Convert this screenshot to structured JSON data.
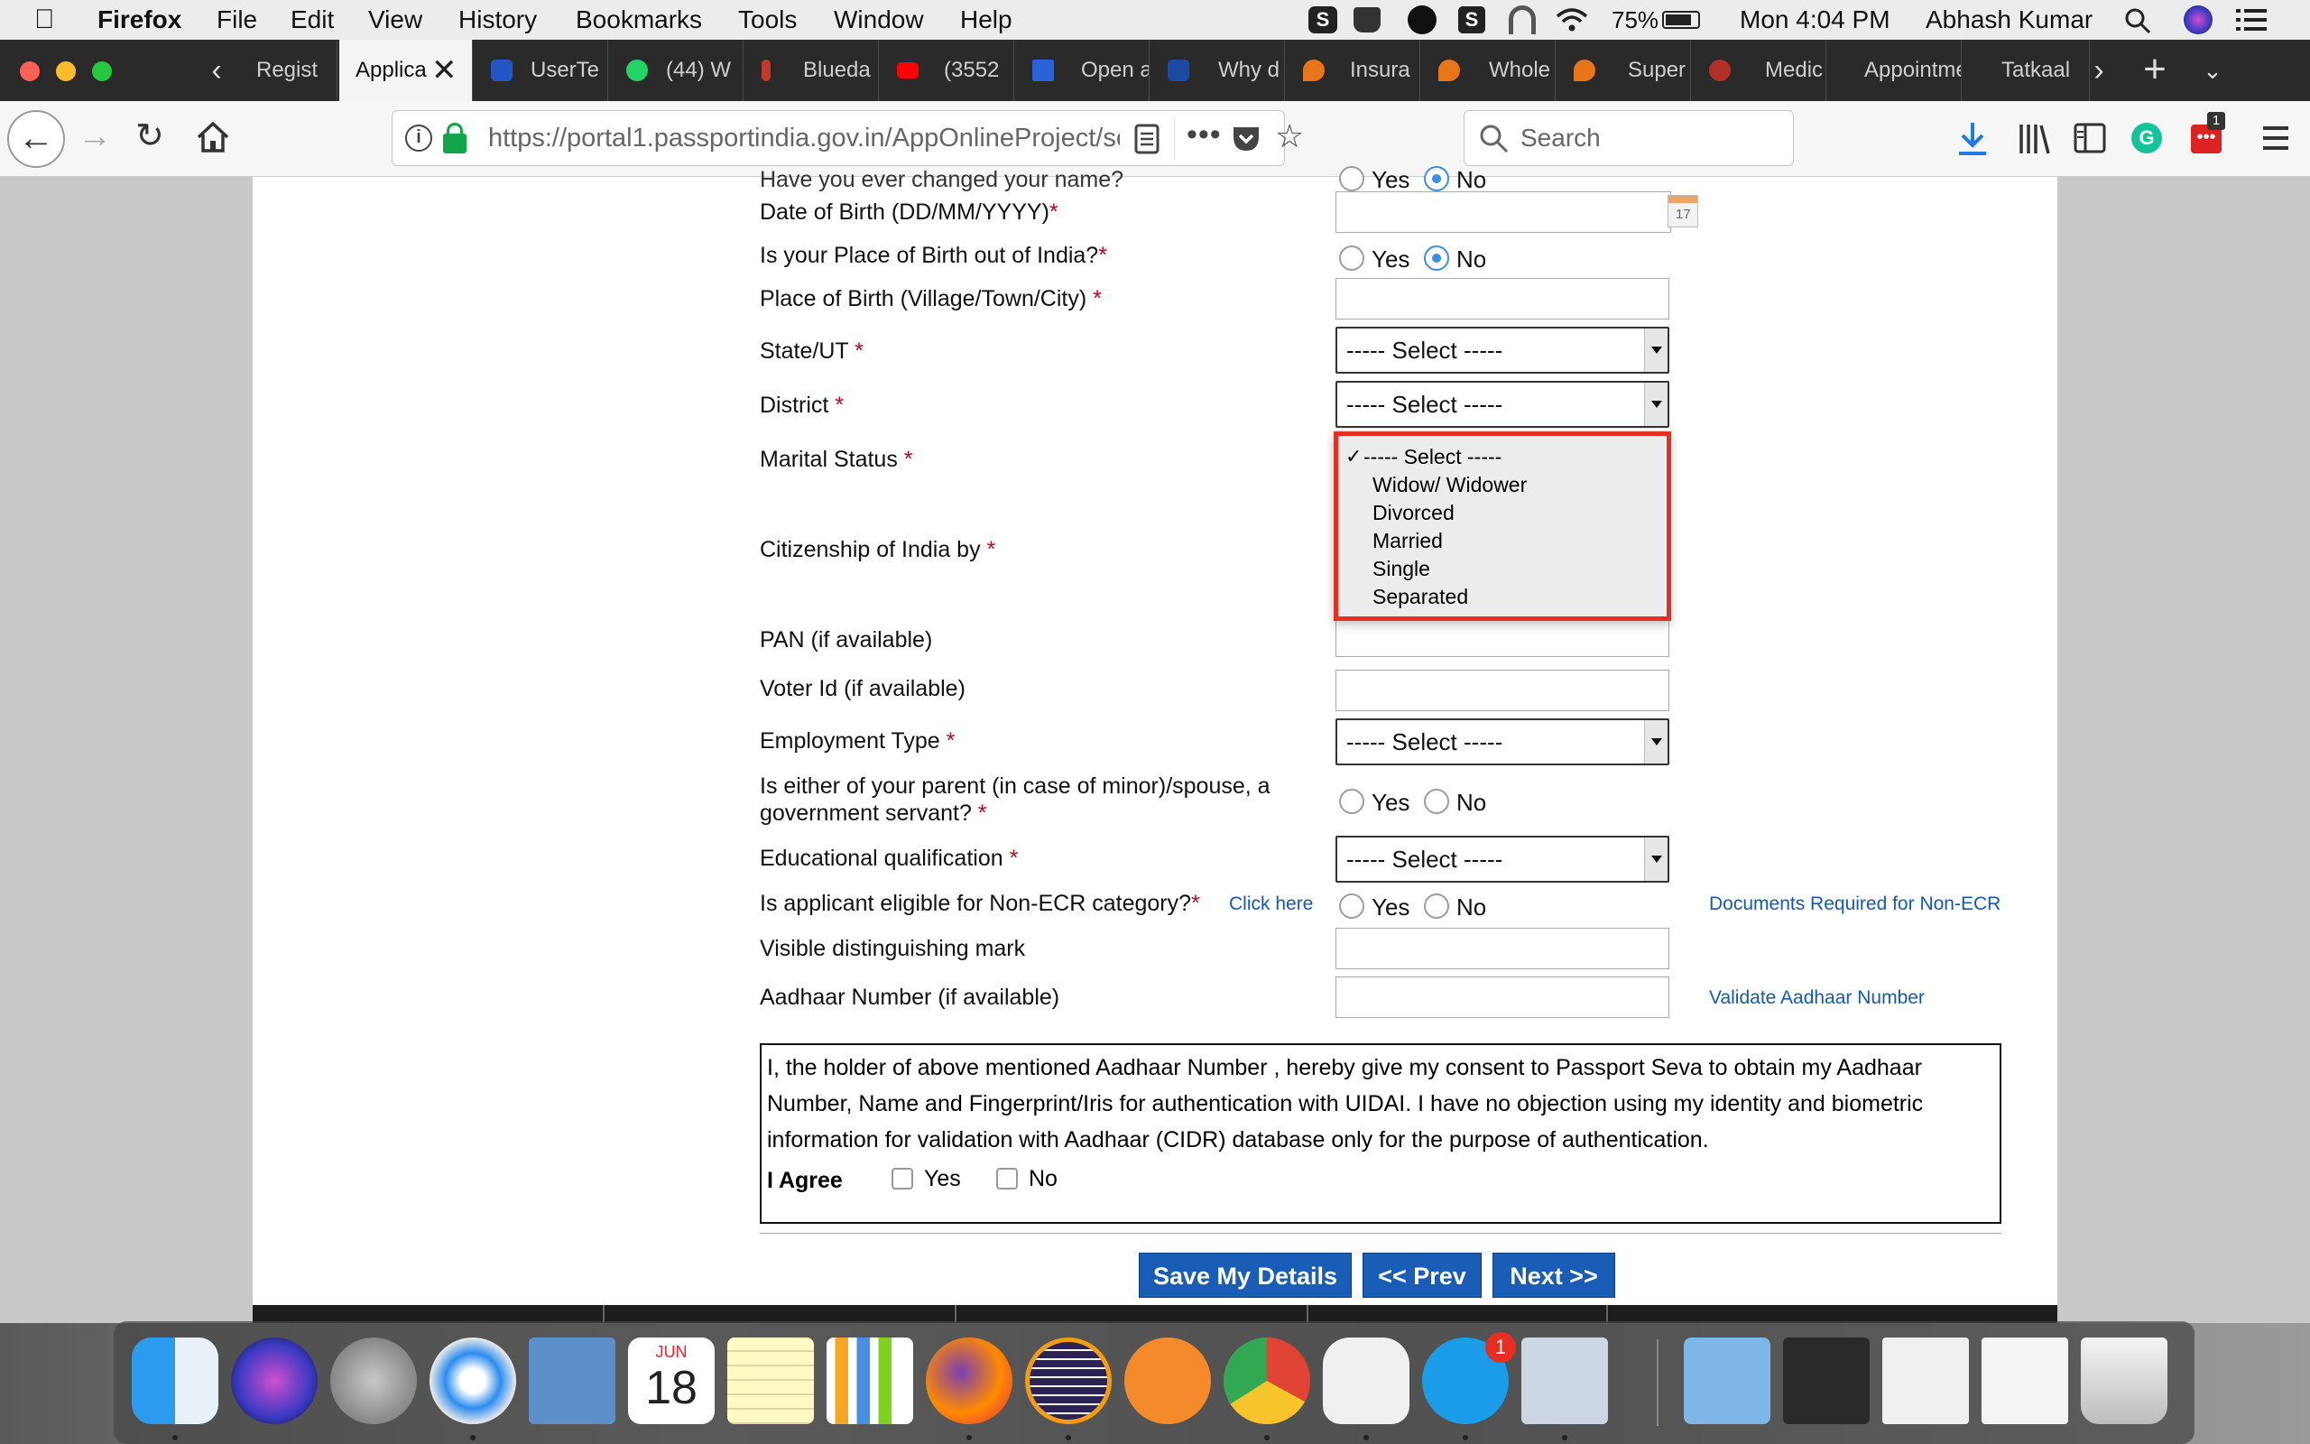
{
  "menubar": {
    "app_name": "Firefox",
    "menus": [
      "File",
      "Edit",
      "View",
      "History",
      "Bookmarks",
      "Tools",
      "Window",
      "Help"
    ],
    "battery": "75%",
    "clock": "Mon 4:04 PM",
    "user": "Abhash Kumar"
  },
  "tabs": [
    {
      "label": "Regist",
      "color": "#c0392b"
    },
    {
      "label": "Applica",
      "color": "#f4f4f4"
    },
    {
      "label": "UserTe",
      "color": "#2457c5"
    },
    {
      "label": "(44) W",
      "color": "#25d366"
    },
    {
      "label": "Bluedа",
      "color": "#c0392b"
    },
    {
      "label": "(3552",
      "color": "#ff0000"
    },
    {
      "label": "Open a",
      "color": "#2b62d9"
    },
    {
      "label": "Why d",
      "color": "#1b4aa0"
    },
    {
      "label": "Insura",
      "color": "#e8751a"
    },
    {
      "label": "Whole",
      "color": "#e8751a"
    },
    {
      "label": "Super",
      "color": "#e8751a"
    },
    {
      "label": "Medic",
      "color": "#b0302a"
    },
    {
      "label": "Appointme",
      "color": "#2a2a2a"
    },
    {
      "label": "Tatkaal",
      "color": "#2a2a2a"
    }
  ],
  "navbar": {
    "url": "https://portal1.passportindia.gov.in/AppOnlineProject/secu",
    "url_domain": "portal1.passportindia.gov.in",
    "search_placeholder": "Search",
    "badge": "1"
  },
  "form": {
    "changed_name_label": "Have you ever changed your name?",
    "changed_name_yes": "Yes",
    "changed_name_no": "No",
    "dob_label": "Date of Birth (DD/MM/YYYY)",
    "pob_out_label": "Is your Place of Birth out of India?",
    "yes": "Yes",
    "no": "No",
    "pob_label": "Place of Birth (Village/Town/City) ",
    "state_label": "State/UT ",
    "district_label": "District ",
    "marital_label": "Marital Status ",
    "citizenship_label": "Citizenship of India by ",
    "pan_label": "PAN (if available)",
    "voter_label": "Voter Id (if available)",
    "employment_label": "Employment Type ",
    "govt_servant_label_1": "Is either of your parent (in case of minor)/spouse, a",
    "govt_servant_label_2": "government servant? ",
    "education_label": "Educational qualification ",
    "non_ecr_label": "Is applicant eligible for Non-ECR category?",
    "click_here": "Click here",
    "docs_non_ecr": "Documents Required for Non-ECR",
    "mark_label": "Visible distinguishing mark",
    "aadhaar_label": "Aadhaar Number (if available)",
    "validate_aadhaar": "Validate Aadhaar Number",
    "select_placeholder": "----- Select -----",
    "required_mark": "*"
  },
  "marital_dropdown": {
    "selected": "----- Select -----",
    "options": [
      "Widow/ Widower",
      "Divorced",
      "Married",
      "Single",
      "Separated"
    ]
  },
  "consent": {
    "line1": "I, the holder of above mentioned Aadhaar Number , hereby give my consent to Passport Seva to obtain my Aadhaar",
    "line2": "Number, Name and Fingerprint/Iris for authentication with UIDAI. I have no objection using my identity and biometric",
    "line3": "information for validation with Aadhaar (CIDR) database only for the purpose of authentication.",
    "agree_label": "I Agree",
    "yes": "Yes",
    "no": "No"
  },
  "buttons": {
    "save": "Save My Details",
    "prev": "<< Prev",
    "next": "Next >>"
  },
  "calendar": {
    "month": "JUN",
    "day": "18"
  },
  "dock_badges": {
    "skype": "1"
  }
}
